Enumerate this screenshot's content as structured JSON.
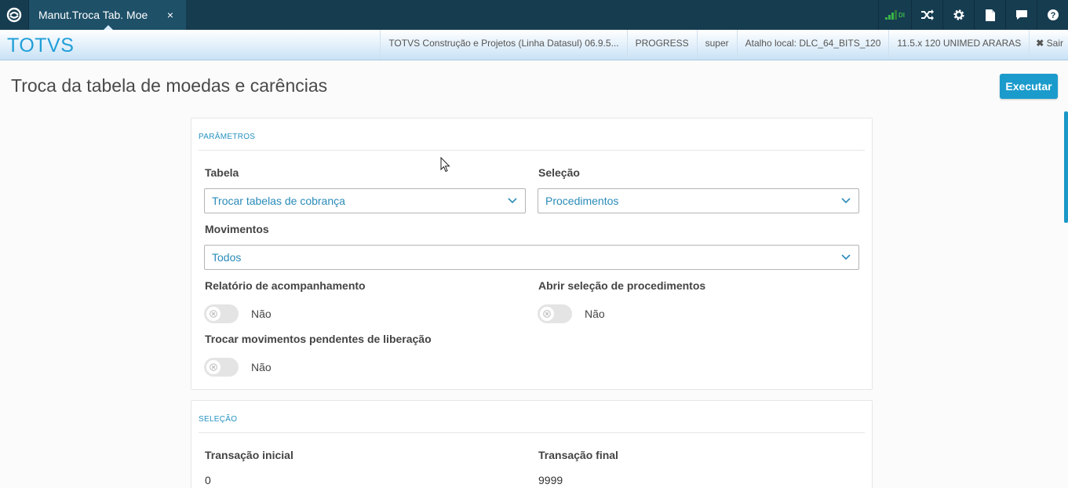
{
  "topbar": {
    "tab_title": "Manut.Troca Tab. Moe",
    "tab_close": "×",
    "signal_label": "DI"
  },
  "subbar": {
    "brand": "TOTVS",
    "system": "TOTVS Construção e Projetos (Linha Datasul) 06.9.5...",
    "database": "PROGRESS",
    "user": "super",
    "shortcut": "Atalho local: DLC_64_BITS_120",
    "company": "11.5.x 120 UNIMED ARARAS",
    "logout_label": "Sair"
  },
  "page": {
    "title": "Troca da tabela de moedas e carências",
    "execute_label": "Executar"
  },
  "parametros": {
    "section_title": "PARÂMETROS",
    "tabela": {
      "label": "Tabela",
      "value": "Trocar tabelas de cobrança"
    },
    "selecao": {
      "label": "Seleção",
      "value": "Procedimentos"
    },
    "movimentos": {
      "label": "Movimentos",
      "value": "Todos"
    },
    "relatorio": {
      "label": "Relatório de acompanhamento",
      "state": "Não"
    },
    "abrir_selecao": {
      "label": "Abrir seleção de procedimentos",
      "state": "Não"
    },
    "trocar_pendentes": {
      "label": "Trocar movimentos pendentes de liberação",
      "state": "Não"
    }
  },
  "selecao": {
    "section_title": "SELEÇÃO",
    "transacao_inicial": {
      "label": "Transação inicial",
      "value": "0"
    },
    "transacao_final": {
      "label": "Transação final",
      "value": "9999"
    }
  },
  "colors": {
    "topbar": "#163c50",
    "accent": "#1b9bcc",
    "brand": "#1f9fd8"
  }
}
